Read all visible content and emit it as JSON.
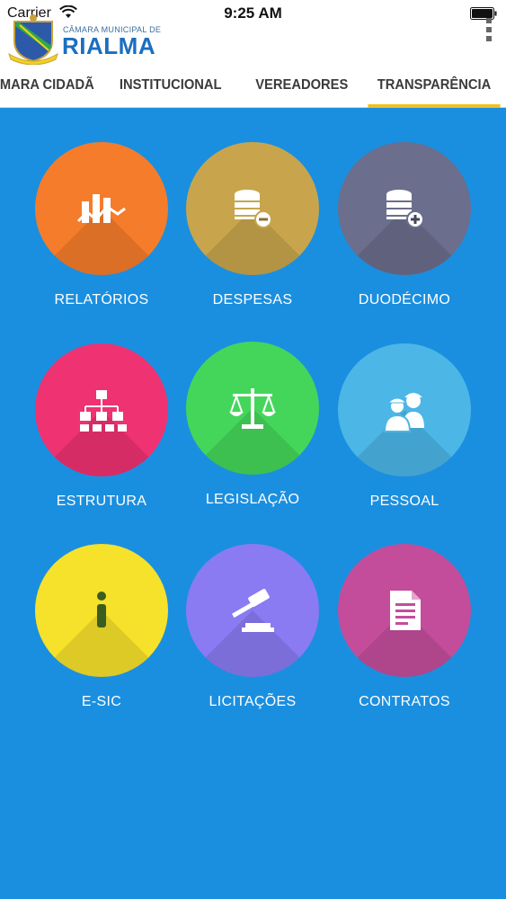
{
  "status_bar": {
    "carrier": "Carrier",
    "time": "9:25 AM"
  },
  "logo": {
    "subtitle": "CÂMARA MUNICIPAL DE",
    "title": "RIALMA"
  },
  "tabs": [
    {
      "label": "MARA CIDADÃ",
      "active": false
    },
    {
      "label": "INSTITUCIONAL",
      "active": false
    },
    {
      "label": "VEREADORES",
      "active": false
    },
    {
      "label": "TRANSPARÊNCIA",
      "active": true
    }
  ],
  "tiles": [
    {
      "label": "RELATÓRIOS",
      "icon": "chart-report-icon",
      "color": "#f57c2b"
    },
    {
      "label": "DESPESAS",
      "icon": "coins-minus-icon",
      "color": "#c8a54c"
    },
    {
      "label": "DUODÉCIMO",
      "icon": "coins-plus-icon",
      "color": "#6b6e8c"
    },
    {
      "label": "ESTRUTURA",
      "icon": "org-chart-icon",
      "color": "#ef3272"
    },
    {
      "label": "LEGISLAÇÃO",
      "icon": "scales-icon",
      "color": "#44d65a"
    },
    {
      "label": "PESSOAL",
      "icon": "workers-icon",
      "color": "#4cb6e6"
    },
    {
      "label": "E-SIC",
      "icon": "info-icon",
      "color": "#f6e12b"
    },
    {
      "label": "LICITAÇÕES",
      "icon": "gavel-icon",
      "color": "#8a7bf2"
    },
    {
      "label": "CONTRATOS",
      "icon": "document-icon",
      "color": "#c34d9b"
    }
  ],
  "colors": {
    "background": "#1a8fe0",
    "tab_indicator": "#f2c01c",
    "logo_blue": "#1a6fc0"
  }
}
